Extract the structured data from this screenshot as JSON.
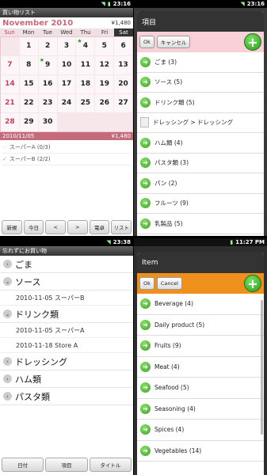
{
  "status": {
    "time_1": "23:16",
    "time_2": "23:16",
    "time_3": "23:38",
    "time_4": "11:27 PM"
  },
  "q1": {
    "app_title": "買い物リスト",
    "month": "November 2010",
    "amount": "¥1,480",
    "days_of_week": [
      "Sun",
      "Mon",
      "Tue",
      "Wed",
      "Thu",
      "Fri",
      "Sat"
    ],
    "weeks": [
      [
        "",
        "1",
        "2",
        "3",
        "4",
        "5",
        "6"
      ],
      [
        "7",
        "8",
        "9",
        "10",
        "11",
        "12",
        "13"
      ],
      [
        "14",
        "15",
        "16",
        "17",
        "18",
        "19",
        "20"
      ],
      [
        "21",
        "22",
        "23",
        "24",
        "25",
        "26",
        "27"
      ],
      [
        "28",
        "29",
        "30",
        "",
        "",
        "",
        ""
      ]
    ],
    "selected_date": "2010/11/05",
    "selected_amount": "¥1,480",
    "lists": [
      {
        "label": "スーパーA (0/3)",
        "checked": false
      },
      {
        "label": "スーパーB (2/2)",
        "checked": true
      }
    ],
    "buttons": [
      "新規",
      "今日",
      "<",
      ">",
      "電卓",
      "リスト"
    ]
  },
  "q2": {
    "dialog_title": "項目",
    "ok": "Ok",
    "cancel": "キャンセル",
    "items": [
      {
        "label": "ごま (3)",
        "type": "arrow"
      },
      {
        "label": "ソース (5)",
        "type": "arrow"
      },
      {
        "label": "ドリンク類 (5)",
        "type": "arrow"
      },
      {
        "label": "ドレッシング > ドレッシング",
        "type": "doc"
      },
      {
        "label": "ハム類 (4)",
        "type": "arrow"
      },
      {
        "label": "パスタ類 (3)",
        "type": "arrow"
      },
      {
        "label": "パン (2)",
        "type": "arrow"
      },
      {
        "label": "フルーツ (9)",
        "type": "arrow"
      },
      {
        "label": "乳製品 (5)",
        "type": "arrow"
      }
    ]
  },
  "q3": {
    "app_title": "忘れずにお買い物",
    "groups": [
      {
        "label": "ごま",
        "subs": []
      },
      {
        "label": "ソース",
        "subs": [
          "2010-11-05 スーパーB"
        ]
      },
      {
        "label": "ドリンク類",
        "subs": [
          "2010-11-05 スーパーA",
          "2010-11-18 Store A"
        ]
      },
      {
        "label": "ドレッシング",
        "subs": []
      },
      {
        "label": "ハム類",
        "subs": []
      },
      {
        "label": "パスタ類",
        "subs": []
      }
    ],
    "buttons": [
      "日付",
      "項目",
      "タイトル"
    ]
  },
  "q4": {
    "dialog_title": "Item",
    "ok": "Ok",
    "cancel": "Cancel",
    "items": [
      "Beverage  (4)",
      "Daily product  (5)",
      "Fruits  (9)",
      "Meat  (4)",
      "Seafood  (5)",
      "Seasoning  (4)",
      "Spices  (4)",
      "Vegetables  (14)"
    ]
  }
}
